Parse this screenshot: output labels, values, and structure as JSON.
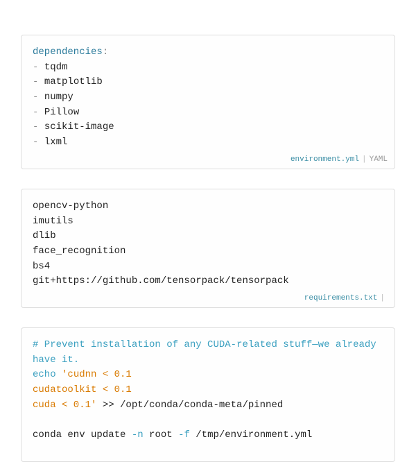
{
  "block1": {
    "key": "dependencies",
    "items": [
      "tqdm",
      "matplotlib",
      "numpy",
      "Pillow",
      "scikit-image",
      "lxml"
    ],
    "filename": "environment.yml",
    "lang": "YAML"
  },
  "block2": {
    "lines": [
      "opencv-python",
      "imutils",
      "dlib",
      "face_recognition",
      "bs4",
      "git+https://github.com/tensorpack/tensorpack"
    ],
    "filename": "requirements.txt",
    "lang": ""
  },
  "block3": {
    "comment": "# Prevent installation of any CUDA-related stuff—we already have it.",
    "echo": "echo",
    "string1": "'cudnn < 0.1",
    "string2": "cudatoolkit < 0.1",
    "string3": "cuda < 0.1'",
    "redirect": " >> /opt/conda/conda-meta/pinned",
    "partial_cmd_pre": "conda env update ",
    "partial_flag1": "-n",
    "partial_mid": " root ",
    "partial_flag2": "-f",
    "partial_end": " /tmp/environment.yml"
  }
}
